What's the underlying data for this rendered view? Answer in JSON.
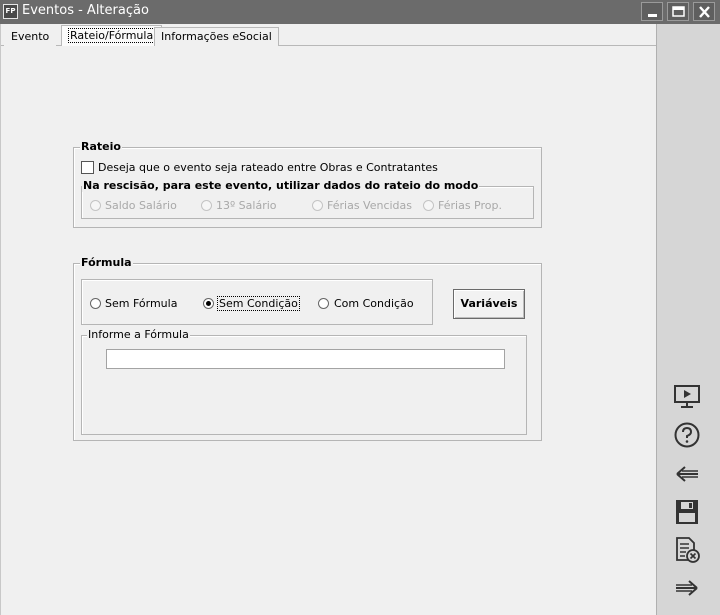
{
  "window": {
    "icon_text": "FP",
    "title": "Eventos - Alteração",
    "controls": [
      "minimize-icon",
      "maximize-icon",
      "close-icon"
    ]
  },
  "tabs": [
    {
      "label": "Evento",
      "active": false
    },
    {
      "label": "Rateio/Fórmula",
      "active": true
    },
    {
      "label": "Informações eSocial",
      "active": false
    }
  ],
  "rateio": {
    "title": "Rateio",
    "checkbox_label": "Deseja que o evento seja rateado entre Obras e Contratantes",
    "checked": false,
    "rescisao": {
      "title": "Na rescisão, para este evento, utilizar dados do rateio do modo",
      "options": [
        "Saldo Salário",
        "13º Salário",
        "Férias Vencidas",
        "Férias Prop."
      ],
      "enabled": false
    }
  },
  "formula": {
    "title": "Fórmula",
    "options": [
      "Sem Fórmula",
      "Sem Condição",
      "Com Condição"
    ],
    "selected": "Sem Condição",
    "variables_button": "Variáveis",
    "input_group_label": "Informe a Fórmula",
    "input_value": ""
  },
  "sidebar": {
    "icons": [
      "presentation-icon",
      "help-icon",
      "back-arrow-icon",
      "save-icon",
      "cancel-document-icon",
      "forward-arrow-icon"
    ]
  }
}
